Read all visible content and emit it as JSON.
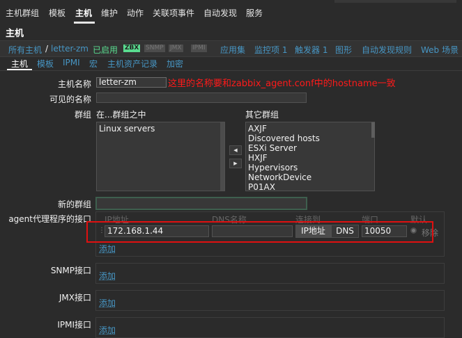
{
  "topnav": {
    "items": [
      "主机群组",
      "模板",
      "主机",
      "维护",
      "动作",
      "关联项事件",
      "自动发现",
      "服务"
    ],
    "active_index": 2
  },
  "page_title": "主机",
  "breadcrumb": {
    "all_hosts": "所有主机",
    "separator": "/",
    "host": "letter-zm",
    "status": "已启用",
    "badges": [
      "ZBX",
      "SNMP",
      "JMX",
      "IPMI"
    ],
    "links": [
      "应用集",
      "监控项 1",
      "触发器 1",
      "图形",
      "自动发现规则",
      "Web 场景"
    ]
  },
  "tabs": [
    "主机",
    "模板",
    "IPMI",
    "宏",
    "主机资产记录",
    "加密"
  ],
  "form": {
    "hostname_label": "主机名称",
    "hostname_value": "letter-zm",
    "visible_name_label": "可见的名称",
    "visible_name_value": "",
    "groups_label": "群组",
    "in_groups_label": "在...群组之中",
    "other_groups_label": "其它群组",
    "in_groups": [
      "Linux servers"
    ],
    "other_groups": [
      "AXJF",
      "Discovered hosts",
      "ESXi Server",
      "HXJF",
      "Hypervisors",
      "NetworkDevice",
      "P01AX"
    ],
    "new_group_label": "新的群组",
    "new_group_value": "",
    "agent_label": "agent代理程序的接口",
    "iface_headers": {
      "ip": "IP地址",
      "dns": "DNS名称",
      "connect": "连接到",
      "port": "端口",
      "default": "默认"
    },
    "ip_value": "172.168.1.44",
    "dns_value": "",
    "connect_ip": "IP地址",
    "connect_dns": "DNS",
    "port_value": "10050",
    "remove_label": "移除",
    "add_label": "添加",
    "snmp_label": "SNMP接口",
    "jmx_label": "JMX接口",
    "ipmi_label": "IPMI接口"
  },
  "annotation": "这里的名称要和zabbix_agent.conf中的hostname一致",
  "colors": {
    "background": "#2b2b2b",
    "link": "#4796c4",
    "enabled": "#59db8f",
    "annotation": "#ff1a1a"
  }
}
